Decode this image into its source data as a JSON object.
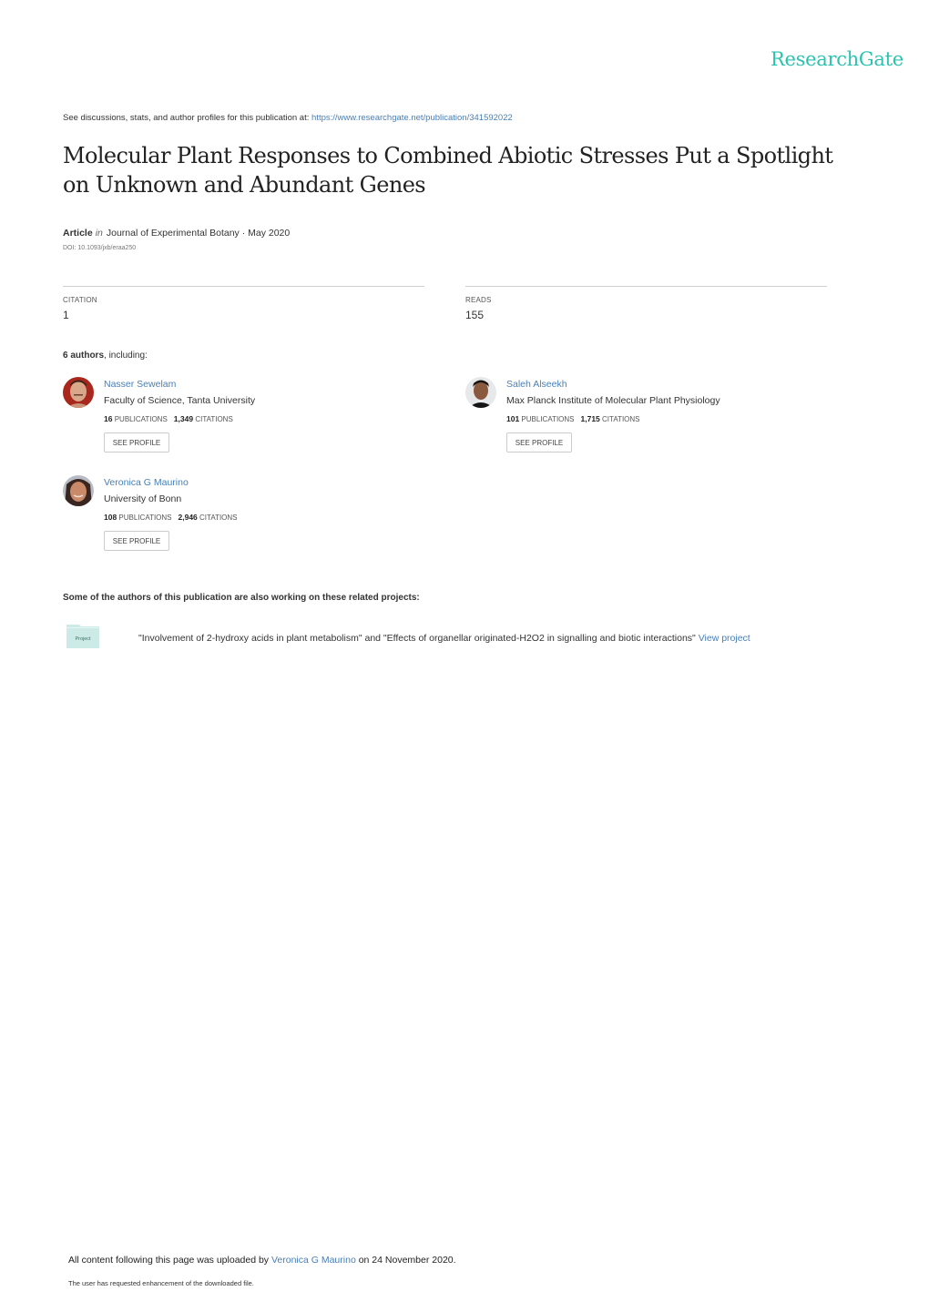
{
  "brand": {
    "logo_text": "ResearchGate",
    "color": "#2ac3b0"
  },
  "header": {
    "intro_text": "See discussions, stats, and author profiles for this publication at: ",
    "url": "https://www.researchgate.net/publication/341592022"
  },
  "publication": {
    "title": "Molecular Plant Responses to Combined Abiotic Stresses Put a Spotlight on Unknown and Abundant Genes",
    "type": "Article",
    "in_label": "in",
    "journal_date": "Journal of Experimental Botany · May 2020",
    "doi": "DOI: 10.1093/jxb/eraa250"
  },
  "stats": {
    "citation_label": "CITATION",
    "citation_value": "1",
    "reads_label": "READS",
    "reads_value": "155"
  },
  "authors_section": {
    "count_bold": "6 authors",
    "suffix": ", including:",
    "publications_label": "PUBLICATIONS",
    "citations_label": "CITATIONS",
    "see_profile_label": "SEE PROFILE",
    "authors": [
      {
        "name": "Nasser Sewelam",
        "institution": "Faculty of Science, Tanta University",
        "publications": "16",
        "citations": "1,349",
        "avatar": "avatar-photo"
      },
      {
        "name": "Saleh Alseekh",
        "institution": "Max Planck Institute of Molecular Plant Physiology",
        "publications": "101",
        "citations": "1,715",
        "avatar": "avatar-photo"
      },
      {
        "name": "Veronica G Maurino",
        "institution": "University of Bonn",
        "publications": "108",
        "citations": "2,946",
        "avatar": "avatar-photo"
      }
    ]
  },
  "projects": {
    "heading": "Some of the authors of this publication are also working on these related projects:",
    "icon_label": "Project",
    "items": [
      {
        "text": "\"Involvement of 2-hydroxy acids in plant metabolism\" and \"Effects of organellar originated-H2O2 in signalling and biotic interactions\" ",
        "link": "View project"
      }
    ]
  },
  "footer": {
    "upload_prefix": "All content following this page was uploaded by ",
    "uploader": "Veronica G Maurino",
    "upload_suffix": " on 24 November 2020.",
    "enhancement_note": "The user has requested enhancement of the downloaded file."
  },
  "colors": {
    "link": "#4a7fb5",
    "text": "#333333",
    "rule": "#cfcfcf",
    "project_icon": "#cdebe6"
  }
}
